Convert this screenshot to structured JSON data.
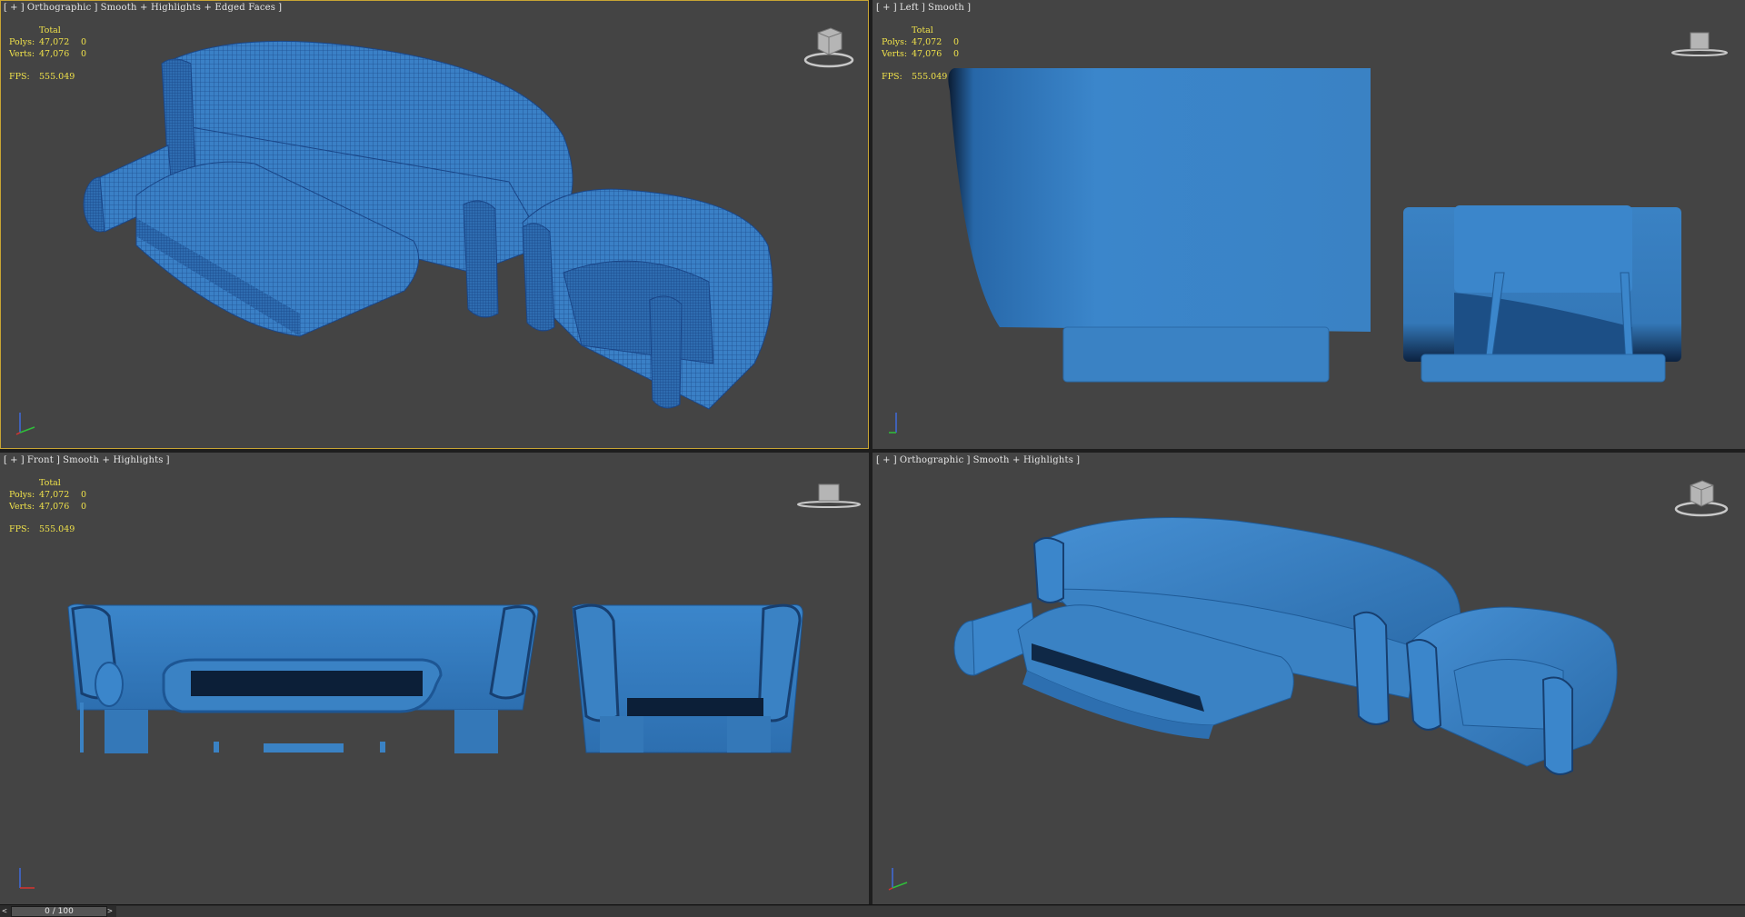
{
  "viewports": [
    {
      "label": [
        "[",
        "+",
        "]",
        "Orthographic",
        "]",
        "Smooth + Highlights + Edged Faces",
        "]"
      ],
      "stats": {
        "header": "Total",
        "polys_label": "Polys:",
        "polys": "47,072",
        "polys_sel": "0",
        "verts_label": "Verts:",
        "verts": "47,076",
        "verts_sel": "0",
        "fps_label": "FPS:",
        "fps": "555.049"
      }
    },
    {
      "label": [
        "[",
        "+",
        "]",
        "Left",
        "]",
        "Smooth",
        "]"
      ],
      "stats": {
        "header": "Total",
        "polys_label": "Polys:",
        "polys": "47,072",
        "polys_sel": "0",
        "verts_label": "Verts:",
        "verts": "47,076",
        "verts_sel": "0",
        "fps_label": "FPS:",
        "fps": "555.049"
      }
    },
    {
      "label": [
        "[",
        "+",
        "]",
        "Front",
        "]",
        "Smooth + Highlights",
        "]"
      ],
      "stats": {
        "header": "Total",
        "polys_label": "Polys:",
        "polys": "47,072",
        "polys_sel": "0",
        "verts_label": "Verts:",
        "verts": "47,076",
        "verts_sel": "0",
        "fps_label": "FPS:",
        "fps": "555.049"
      }
    },
    {
      "label": [
        "[",
        "+",
        "]",
        "Orthographic",
        "]",
        "Smooth + Highlights",
        "]"
      ]
    }
  ],
  "timebar": {
    "position": "0 / 100",
    "prev": "<",
    "next": ">"
  },
  "colors": {
    "viewport_bg": "#444444",
    "model": "#3a82c4",
    "active_border": "#c8a534",
    "stats": "#f0e24a"
  }
}
